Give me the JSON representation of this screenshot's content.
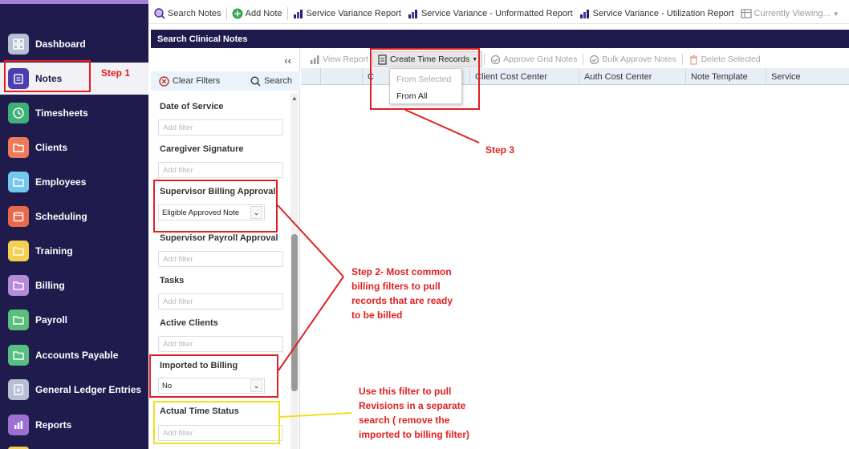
{
  "sidebar": {
    "items": [
      {
        "label": "Dashboard"
      },
      {
        "label": "Notes"
      },
      {
        "label": "Timesheets"
      },
      {
        "label": "Clients"
      },
      {
        "label": "Employees"
      },
      {
        "label": "Scheduling"
      },
      {
        "label": "Training"
      },
      {
        "label": "Billing"
      },
      {
        "label": "Payroll"
      },
      {
        "label": "Accounts Payable"
      },
      {
        "label": "General Ledger Entries"
      },
      {
        "label": "Reports"
      }
    ]
  },
  "toolbar": {
    "search_notes": "Search Notes",
    "add_note": "Add Note",
    "service_variance_report": "Service Variance Report",
    "service_variance_unformatted": "Service Variance - Unformatted Report",
    "service_variance_utilization": "Service Variance - Utilization Report",
    "currently_viewing": "Currently Viewing..."
  },
  "header": {
    "title": "Search Clinical Notes"
  },
  "filters": {
    "clear_filters": "Clear Filters",
    "search": "Search",
    "collapse": "‹‹",
    "placeholder": "Add filter",
    "date_of_service": "Date of Service",
    "caregiver_signature": "Caregiver Signature",
    "supervisor_billing_approval": "Supervisor Billing Approval",
    "supervisor_billing_value": "Eligible Approved Note",
    "supervisor_payroll_approval": "Supervisor Payroll Approval",
    "tasks": "Tasks",
    "active_clients": "Active Clients",
    "imported_to_billing": "Imported to Billing",
    "imported_to_billing_value": "No",
    "actual_time_status": "Actual Time Status"
  },
  "grid_toolbar": {
    "view_report": "View Report",
    "create_time_records": "Create Time Records",
    "approve_grid_notes": "Approve Grid Notes",
    "bulk_approve_notes": "Bulk Approve Notes",
    "delete_selected": "Delete Selected"
  },
  "create_time_records_menu": {
    "from_selected": "From Selected",
    "from_all": "From All"
  },
  "grid": {
    "columns": [
      "C",
      "Client Cost Center",
      "Auth Cost Center",
      "Note Template",
      "Service"
    ]
  },
  "annotations": {
    "step1": "Step 1",
    "step2_lines": [
      "Step 2- Most common",
      "billing filters to pull",
      "records that are ready",
      "to be billed"
    ],
    "step3": "Step 3",
    "revisions_lines": [
      "Use this filter to pull",
      "Revisions in a separate",
      "search ( remove the",
      "imported to billing filter)"
    ]
  },
  "colors": {
    "sidebar_bg": "#1f1b4d",
    "accent_top": "#a67fd6",
    "annotation_red": "#e02020",
    "annotation_yellow": "#f0e020"
  }
}
